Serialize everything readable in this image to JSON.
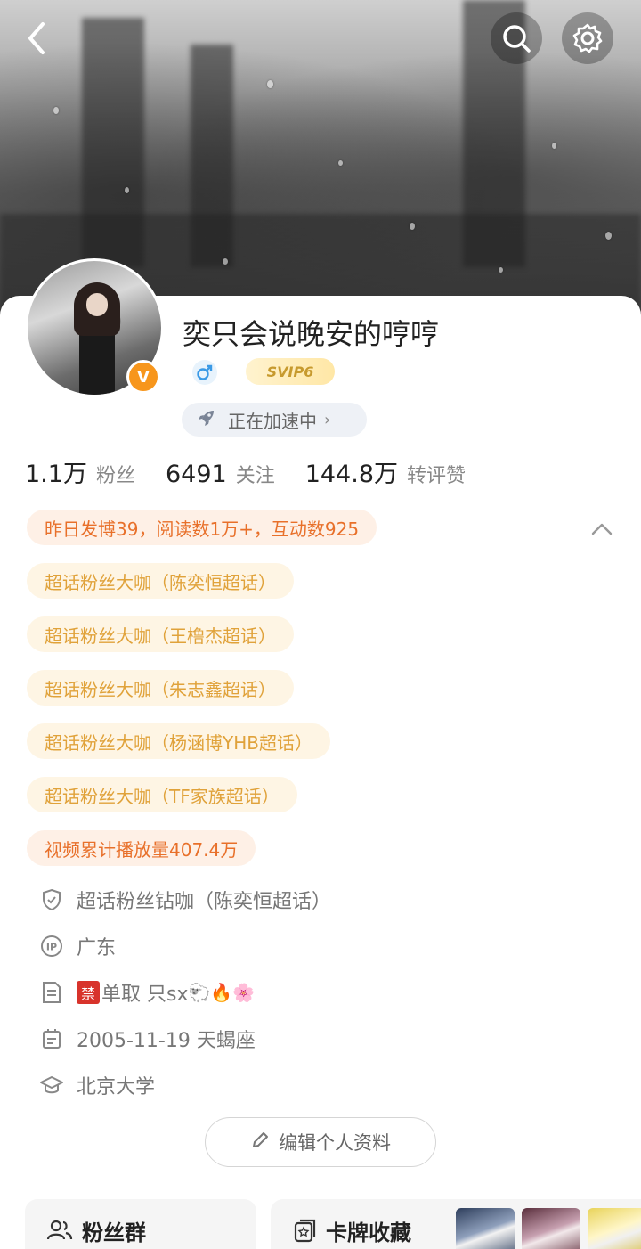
{
  "header": {
    "back_icon": "chevron-left-icon",
    "search_icon": "search-icon",
    "settings_icon": "gear-icon"
  },
  "profile": {
    "name": "奕只会说晚安的哼哼",
    "verified_badge": "V",
    "gender_icon": "male-icon",
    "vip_badge": "SVIP6",
    "boost_label": "正在加速中",
    "accent_color": "#f7961c"
  },
  "stats": [
    {
      "num": "1.1万",
      "label": "粉丝"
    },
    {
      "num": "6491",
      "label": "关注"
    },
    {
      "num": "144.8万",
      "label": "转评赞"
    }
  ],
  "tags": {
    "activity": "昨日发博39，阅读数1万+，互动数925",
    "super_fans": [
      "超话粉丝大咖（陈奕恒超话）",
      "超话粉丝大咖（王橹杰超话）",
      "超话粉丝大咖（朱志鑫超话）",
      "超话粉丝大咖（杨涵博YHB超话）",
      "超话粉丝大咖（TF家族超话）"
    ],
    "video": "视频累计播放量407.4万"
  },
  "info": {
    "diamond_fan": "超话粉丝钻咖（陈奕恒超话）",
    "ip": "广东",
    "bio_ban": "禁",
    "bio_text": "单取 只sx",
    "bio_emojis": "🐑🔥🌸",
    "birthday": "2005-11-19 天蝎座",
    "school": "北京大学"
  },
  "actions": {
    "edit_profile": "编辑个人资料"
  },
  "bottom": {
    "fans_group": "粉丝群",
    "card_collection": "卡牌收藏"
  }
}
